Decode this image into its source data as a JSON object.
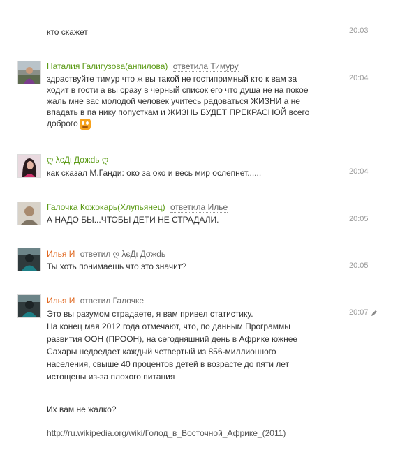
{
  "top_cut_text": "...",
  "messages": [
    {
      "text": "кто скажет",
      "time": "20:03"
    },
    {
      "author": "Наталия Галигузова(анпилова)",
      "reply": "ответила Тимуру",
      "text_lines": [
        "здраствуйте  тимур что ж вы такой не гостипримный кто к вам за",
        "ходит в гости а вы сразу в черный список его что душа не на покое",
        "жаль мне вас молодой человек учитесь радоваться ЖИЗНИ а не",
        "впадать в па нику попусткам и ЖИЗНЬ БУДЕТ ПРЕКРАСНОЙ всего",
        "доброго"
      ],
      "time": "20:04",
      "smiley": "laughing-smiley-icon"
    },
    {
      "author": "ღ λєДι Дσжԁь ღ",
      "text": "как сказал М.Ганди: око за око и весь мир ослепнет......",
      "time": "20:04"
    },
    {
      "author": "Галочка Кожокарь(Хлупьянец)",
      "reply": "ответила Илье",
      "text": "А НАДО БЫ...ЧТОБЫ ДЕТИ НЕ СТРАДАЛИ.",
      "time": "20:05"
    },
    {
      "author": "Илья И",
      "reply": "ответил ღ λєДι Дσжԁь",
      "text": "Ты хоть понимаешь что это значит?",
      "time": "20:05"
    },
    {
      "author": "Илья И",
      "reply": "ответил Галочке",
      "text_lines": [
        "Это вы разумом страдаете, я вам привел статистику.",
        "На конец мая 2012 года отмечают, что, по данным Программы",
        "развития ООН (ПРООН), на сегодняшний день в Африке южнее",
        "Сахары недоедает каждый четвертый из 856-миллионного",
        "населения, свыше 40 процентов детей в возрасте до пяти лет",
        "истощены из-за плохого питания"
      ],
      "question": "Их вам не жалко?",
      "link": "http://ru.wikipedia.org/wiki/Голод_в_Восточной_Африке_(2011)",
      "time": "20:07"
    }
  ]
}
